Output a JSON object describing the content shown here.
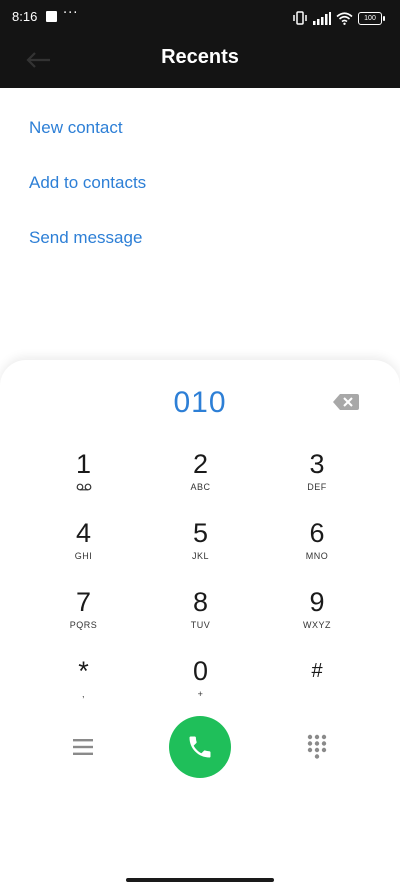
{
  "status_bar": {
    "time": "8:16",
    "notification_more": "···",
    "battery_level": "100"
  },
  "header": {
    "title": "Recents"
  },
  "actions": [
    {
      "label": "New contact"
    },
    {
      "label": "Add to contacts"
    },
    {
      "label": "Send message"
    }
  ],
  "dialpad": {
    "number": "010",
    "keys": [
      {
        "digit": "1",
        "letters": ""
      },
      {
        "digit": "2",
        "letters": "ABC"
      },
      {
        "digit": "3",
        "letters": "DEF"
      },
      {
        "digit": "4",
        "letters": "GHI"
      },
      {
        "digit": "5",
        "letters": "JKL"
      },
      {
        "digit": "6",
        "letters": "MNO"
      },
      {
        "digit": "7",
        "letters": "PQRS"
      },
      {
        "digit": "8",
        "letters": "TUV"
      },
      {
        "digit": "9",
        "letters": "WXYZ"
      },
      {
        "digit": "*",
        "letters": ","
      },
      {
        "digit": "0",
        "letters": "+"
      },
      {
        "digit": "#",
        "letters": ""
      }
    ]
  },
  "colors": {
    "accent": "#2d7fd6",
    "call_green": "#1fbf5a",
    "header_bg": "#141414"
  },
  "icons": {
    "back": "arrow-left-icon",
    "backspace": "backspace-icon",
    "voicemail": "voicemail-icon",
    "menu": "menu-icon",
    "call": "phone-icon",
    "dialpad": "dialpad-grid-icon"
  }
}
